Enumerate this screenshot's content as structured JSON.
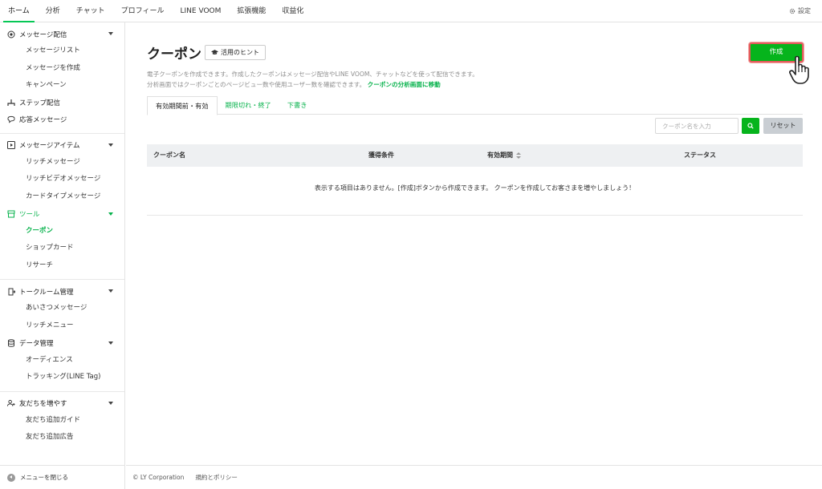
{
  "topnav": {
    "tabs": [
      {
        "label": "ホーム",
        "active": true
      },
      {
        "label": "分析"
      },
      {
        "label": "チャット"
      },
      {
        "label": "プロフィール"
      },
      {
        "label": "LINE VOOM"
      },
      {
        "label": "拡張機能"
      },
      {
        "label": "収益化"
      }
    ],
    "settings_label": "設定"
  },
  "sidebar": {
    "message": {
      "label": "メッセージ配信",
      "items": [
        "メッセージリスト",
        "メッセージを作成",
        "キャンペーン"
      ]
    },
    "step": {
      "label": "ステップ配信"
    },
    "response": {
      "label": "応答メッセージ"
    },
    "items_sec": {
      "label": "メッセージアイテム",
      "items": [
        "リッチメッセージ",
        "リッチビデオメッセージ",
        "カードタイプメッセージ"
      ]
    },
    "tools": {
      "label": "ツール",
      "items": [
        "クーポン",
        "ショップカード",
        "リサーチ"
      ]
    },
    "talkroom": {
      "label": "トークルーム管理",
      "items": [
        "あいさつメッセージ",
        "リッチメニュー"
      ]
    },
    "data": {
      "label": "データ管理",
      "items": [
        "オーディエンス",
        "トラッキング(LINE Tag)"
      ]
    },
    "friends": {
      "label": "友だちを増やす",
      "items": [
        "友だち追加ガイド",
        "友だち追加広告"
      ]
    },
    "close_menu": "メニューを閉じる"
  },
  "main": {
    "title": "クーポン",
    "hint_button": "活用のヒント",
    "create_button": "作成",
    "desc_line1": "電子クーポンを作成できます。作成したクーポンはメッセージ配信やLINE VOOM、チャットなどを使って配信できます。",
    "desc_line2": "分析画面ではクーポンごとのページビュー数や使用ユーザー数を確認できます。",
    "desc_link": "クーポンの分析画面に移動",
    "tabs": [
      {
        "label": "有効期間前・有効",
        "active": true
      },
      {
        "label": "期限切れ・終了"
      },
      {
        "label": "下書き"
      }
    ],
    "search_placeholder": "クーポン名を入力",
    "reset_button": "リセット",
    "columns": [
      "クーポン名",
      "獲得条件",
      "有効期間",
      "ステータス"
    ],
    "empty_message": "表示する項目はありません。[作成]ボタンから作成できます。 クーポンを作成してお客さまを増やしましょう！"
  },
  "footer": {
    "copyright": "© LY Corporation",
    "policy": "規約とポリシー"
  },
  "colors": {
    "accent": "#06c755",
    "create_button": "#06b41c",
    "highlight_border": "#e35b5b"
  }
}
